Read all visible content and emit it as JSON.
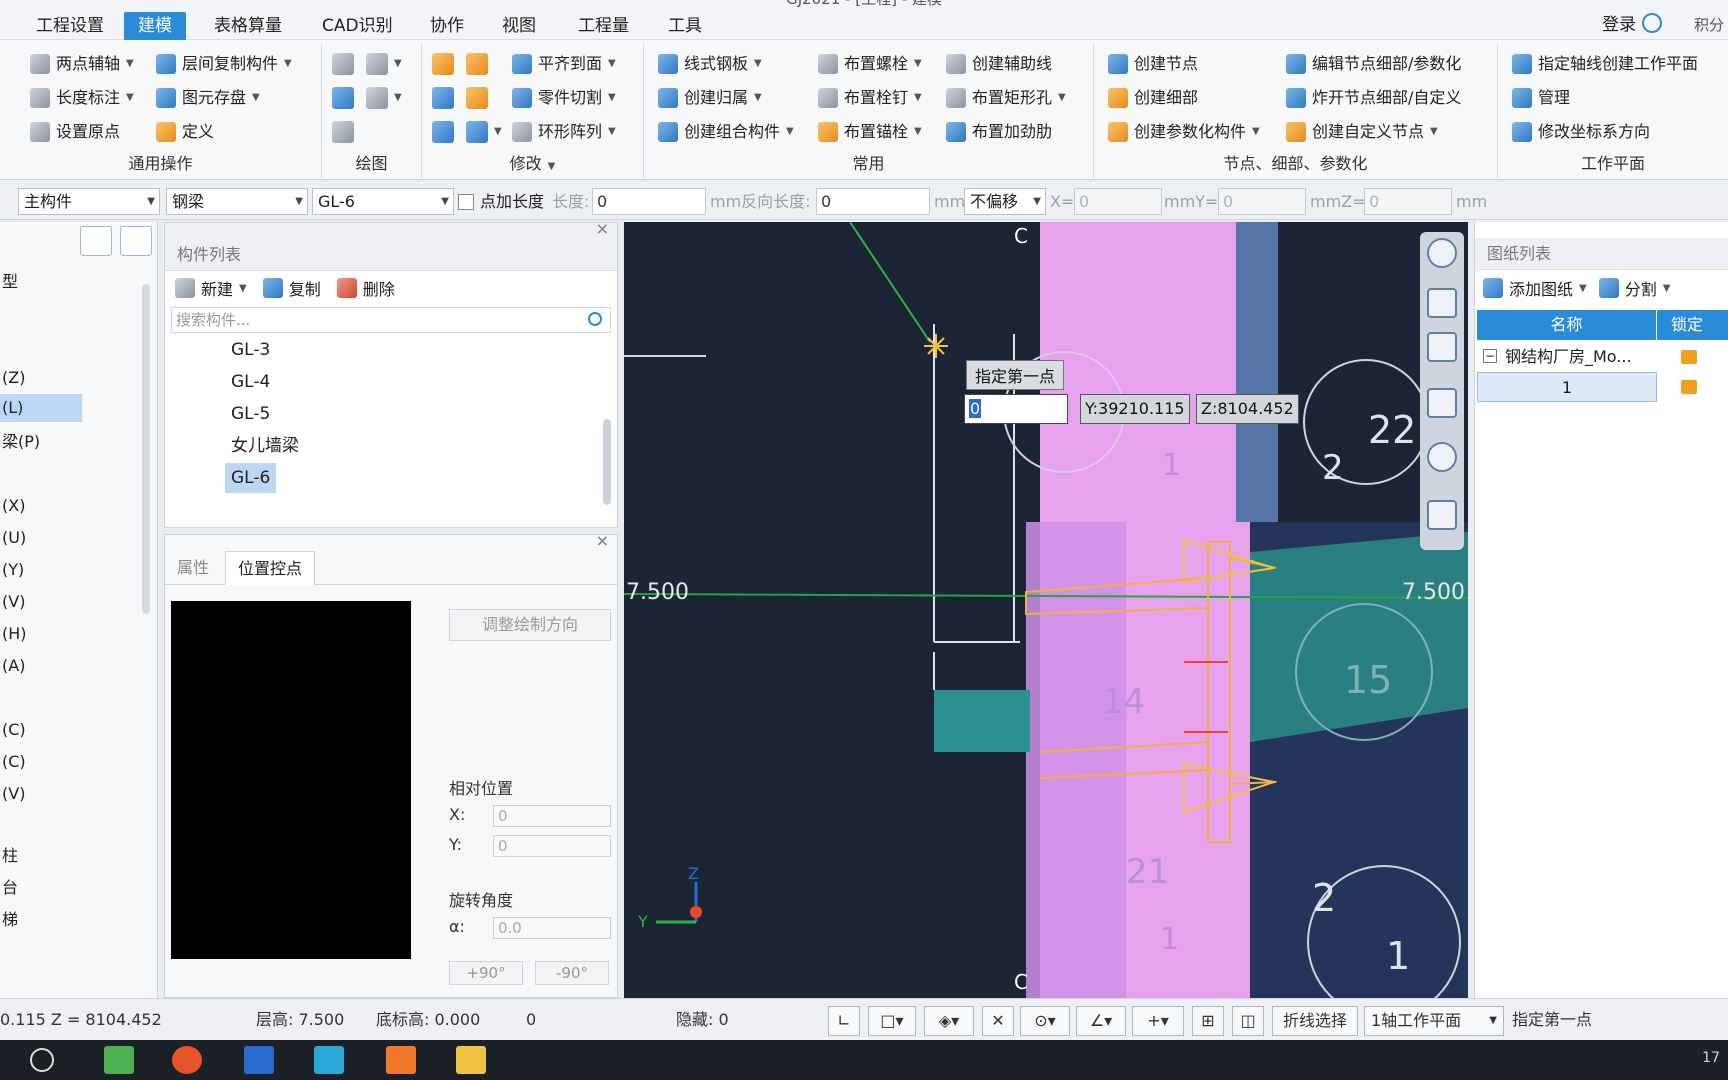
{
  "title": "GJ2021 - [工程] - 建模",
  "menu": [
    "工程设置",
    "建模",
    "表格算量",
    "CAD识别",
    "协作",
    "视图",
    "工程量",
    "工具"
  ],
  "menu_active_index": 1,
  "login": "登录",
  "skin": "积分",
  "ribbon": {
    "general": {
      "label": "通用操作",
      "items": [
        "两点辅轴",
        "层间复制构件",
        "长度标注",
        "图元存盘",
        "设置原点",
        "定义"
      ]
    },
    "draw": {
      "label": "绘图"
    },
    "modify": {
      "label": "修改",
      "items": [
        "平齐到面",
        "零件切割",
        "环形阵列"
      ]
    },
    "common": {
      "label": "常用",
      "items": [
        "线式钢板",
        "创建归属",
        "创建组合构件",
        "布置螺栓",
        "布置栓钉",
        "布置锚栓",
        "创建辅助线",
        "布置矩形孔",
        "布置加劲肋"
      ]
    },
    "nodes": {
      "label": "节点、细部、参数化",
      "items": [
        "创建节点",
        "创建细部",
        "创建参数化构件",
        "编辑节点细部/参数化",
        "炸开节点细部/自定义",
        "创建自定义节点"
      ]
    },
    "workplane": {
      "label": "工作平面",
      "items": [
        "指定轴线创建工作平面",
        "管理",
        "修改坐标系方向"
      ]
    }
  },
  "propbar": {
    "main_component": "主构件",
    "type": "钢梁",
    "name": "GL-6",
    "point_length_label": "点加长度",
    "length_label": "长度:",
    "length_value": "0",
    "reverse_label": "mm反向长度:",
    "reverse_value": "0",
    "unit_mm": "mm",
    "offset": "不偏移",
    "x_label": "X=",
    "x_value": "0",
    "y_label": "mmY=",
    "y_value": "0",
    "z_label": "mmZ=",
    "z_value": "0",
    "end_unit": "mm"
  },
  "leftnav": {
    "items": [
      "型",
      "(Z)",
      "(L)",
      "梁(P)",
      "(X)",
      "(U)",
      "(Y)",
      "(V)",
      "(H)",
      "(A)",
      "",
      "(C)",
      "(C)",
      "(V)",
      "柱",
      "台",
      "梯"
    ],
    "selected_index": 2
  },
  "component_list": {
    "title": "构件列表",
    "new_label": "新建",
    "copy_label": "复制",
    "delete_label": "删除",
    "search_placeholder": "搜索构件...",
    "items": [
      "GL-3",
      "GL-4",
      "GL-5",
      "女儿墙梁",
      "GL-6"
    ],
    "selected_index": 4
  },
  "properties": {
    "tab_attr": "属性",
    "tab_position": "位置控点",
    "adjust_label": "调整绘制方向",
    "relative_position": "相对位置",
    "x_label": "X:",
    "x_value": "0",
    "y_label": "Y:",
    "y_value": "0",
    "rotation_label": "旋转角度",
    "alpha_label": "α:",
    "alpha_value": "0.0",
    "plus90": "+90°",
    "minus90": "-90°"
  },
  "viewport": {
    "tooltip": "指定第一点",
    "input_value": "0",
    "y_readout": "Y:39210.115",
    "z_readout": "Z:8104.452",
    "elev_left": "7.500",
    "elev_right": "7.500",
    "axis_top": "C",
    "axis_bottom": "C",
    "labels": [
      "22",
      "2",
      "14",
      "15",
      "1",
      "21",
      "1",
      "2",
      "1"
    ],
    "triad_y": "Y",
    "triad_z": "Z"
  },
  "drawing_list": {
    "title": "图纸列表",
    "add_label": "添加图纸",
    "split_label": "分割",
    "col_name": "名称",
    "col_lock": "锁定",
    "rows": [
      "钢结构厂房_Mo...",
      "1"
    ]
  },
  "status": {
    "coord": "0.115 Z = 8104.452",
    "floor_height": "层高: 7.500",
    "base_elev": "底标高: 0.000",
    "zero": "0",
    "hidden": "隐藏: 0",
    "polyline": "折线选择",
    "workplane": "1轴工作平面",
    "prompt": "指定第一点"
  },
  "taskbar": {
    "clock": "17"
  },
  "colors": {
    "accent": "#2a8bd8",
    "viewport_bg": "#1c2535",
    "column_pink": "#e7a2ee",
    "beam_teal": "#2a7f80",
    "highlight_orange": "#f0b040"
  }
}
